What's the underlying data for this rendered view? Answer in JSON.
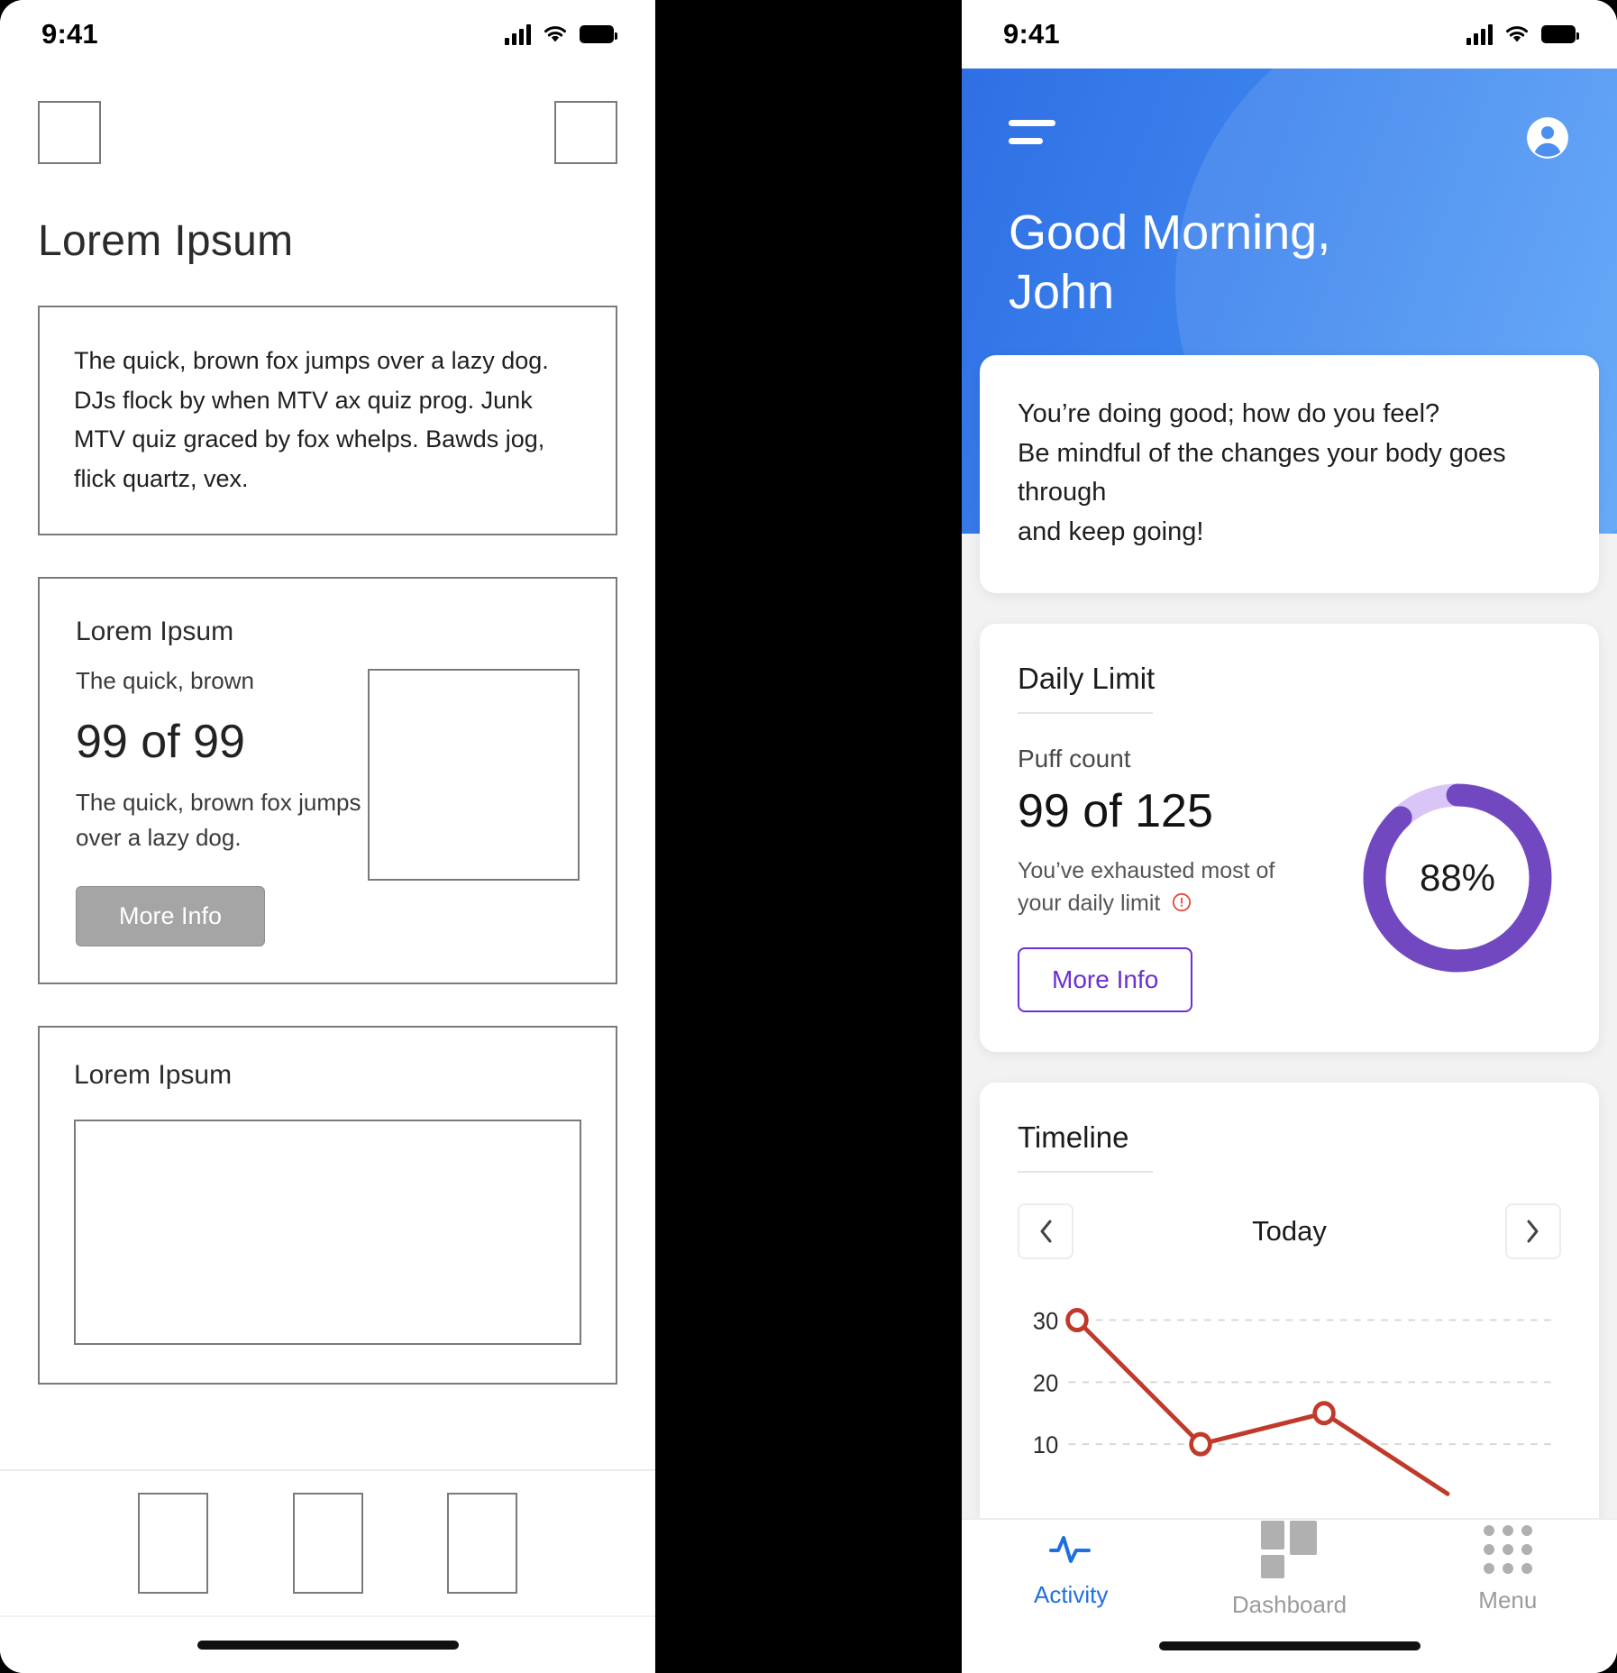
{
  "left_phone": {
    "status": {
      "time": "9:41",
      "signal_icon": "cellular-signal-icon",
      "wifi_icon": "wifi-icon",
      "battery_icon": "battery-icon"
    },
    "title": "Lorem Ipsum",
    "paragraph": "The quick, brown fox jumps over a lazy dog. DJs flock by when MTV ax quiz prog. Junk MTV quiz graced by fox whelps. Bawds jog, flick quartz, vex.",
    "card": {
      "heading": "Lorem Ipsum",
      "subtitle": "The quick, brown",
      "metric": "99 of 99",
      "description": "The quick, brown fox jumps over a lazy dog.",
      "button_label": "More Info"
    },
    "card2": {
      "heading": "Lorem Ipsum"
    },
    "tabbar_placeholder_count": 3
  },
  "right_phone": {
    "status": {
      "time": "9:41",
      "signal_icon": "cellular-signal-icon",
      "wifi_icon": "wifi-icon",
      "battery_icon": "battery-icon"
    },
    "header": {
      "menu_icon": "hamburger-menu-icon",
      "profile_icon": "account-avatar-icon",
      "greeting_line1": "Good Morning,",
      "greeting_line2": "John"
    },
    "message_card": {
      "line1": "You’re doing good; how do you feel?",
      "line2": "Be mindful of the changes your body goes through",
      "line3": "and keep going!"
    },
    "daily_limit": {
      "title": "Daily Limit",
      "metric_label": "Puff count",
      "metric_value": "99 of 125",
      "note_line1": "You’ve exhausted most of",
      "note_line2": "your daily limit",
      "warning_icon": "warning-circle-icon",
      "button_label": "More Info",
      "percent_label": "88%",
      "percent_value": 88,
      "track_color": "#d9c6f7",
      "progress_color": "#7248c0"
    },
    "timeline": {
      "title": "Timeline",
      "prev_icon": "chevron-left-icon",
      "next_icon": "chevron-right-icon",
      "range_label": "Today"
    },
    "bottom_nav": [
      {
        "label": "Activity",
        "icon": "activity-pulse-icon",
        "active": true
      },
      {
        "label": "Dashboard",
        "icon": "dashboard-grid-icon",
        "active": false
      },
      {
        "label": "Menu",
        "icon": "menu-dots-grid-icon",
        "active": false
      }
    ]
  },
  "chart_data": {
    "type": "line",
    "title": "Timeline",
    "xlabel": "",
    "ylabel": "",
    "yticks": [
      10,
      20,
      30
    ],
    "ylim": [
      0,
      34
    ],
    "grid": true,
    "legend": "none",
    "line_color": "#c0392b",
    "marker": "open-circle",
    "x": [
      0,
      1,
      2,
      3
    ],
    "values": [
      30,
      10,
      15,
      2
    ],
    "series": [
      {
        "name": "Puffs",
        "values": [
          30,
          10,
          15,
          2
        ]
      }
    ]
  }
}
